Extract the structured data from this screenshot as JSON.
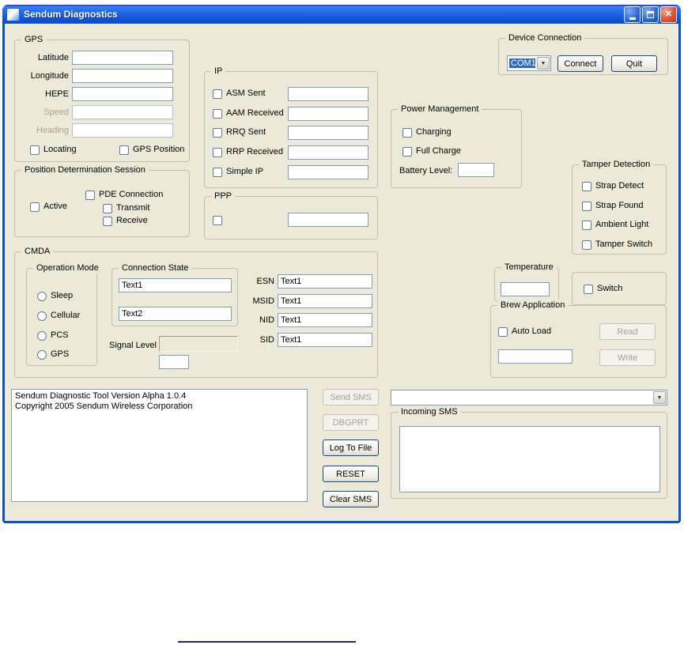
{
  "window": {
    "title": "Sendum Diagnostics"
  },
  "device_connection": {
    "label": "Device Connection",
    "port": "COM1",
    "connect": "Connect",
    "quit": "Quit"
  },
  "gps": {
    "label": "GPS",
    "rows": [
      {
        "label": "Latitude",
        "value": ""
      },
      {
        "label": "Longitude",
        "value": ""
      },
      {
        "label": "HEPE",
        "value": ""
      },
      {
        "label": "Speed",
        "value": ""
      },
      {
        "label": "Heading",
        "value": ""
      }
    ],
    "locating": "Locating",
    "gps_position": "GPS Position"
  },
  "pds": {
    "label": "Position Determination Session",
    "active": "Active",
    "pde_connection": "PDE Connection",
    "transmit": "Transmit",
    "receive": "Receive"
  },
  "ip": {
    "label": "IP",
    "rows": [
      {
        "label": "ASM Sent",
        "value": ""
      },
      {
        "label": "AAM Received",
        "value": ""
      },
      {
        "label": "RRQ Sent",
        "value": ""
      },
      {
        "label": "RRP Received",
        "value": ""
      },
      {
        "label": "Simple IP",
        "value": ""
      }
    ]
  },
  "ppp": {
    "label": "PPP",
    "value": ""
  },
  "power": {
    "label": "Power Management",
    "charging": "Charging",
    "full_charge": "Full Charge",
    "battery_label": "Battery Level:",
    "battery_value": ""
  },
  "tamper": {
    "label": "Tamper Detection",
    "items": [
      "Strap Detect",
      "Strap Found",
      "Ambient Light",
      "Tamper Switch"
    ]
  },
  "cmda": {
    "label": "CMDA",
    "operation_mode": {
      "label": "Operation Mode",
      "options": [
        "Sleep",
        "Cellular",
        "PCS",
        "GPS"
      ]
    },
    "connection_state": {
      "label": "Connection State",
      "line1": "Text1",
      "line2": "Text2"
    },
    "signal_level_label": "Signal Level",
    "signal_level_value": "",
    "ids": [
      {
        "label": "ESN",
        "value": "Text1"
      },
      {
        "label": "MSID",
        "value": "Text1"
      },
      {
        "label": "NID",
        "value": "Text1"
      },
      {
        "label": "SID",
        "value": "Text1"
      }
    ]
  },
  "temperature": {
    "label": "Temperature",
    "value": ""
  },
  "switch_box": {
    "label": "Switch"
  },
  "brew": {
    "label": "Brew Application",
    "auto_load": "Auto Load",
    "read": "Read",
    "write": "Write",
    "value": ""
  },
  "log": {
    "line1": "Sendum Diagnostic Tool Version Alpha 1.0.4",
    "line2": "Copyright 2005 Sendum Wireless Corporation"
  },
  "actions": {
    "send_sms": "Send SMS",
    "dbgprt": "DBGPRT",
    "log_to_file": "Log To File",
    "reset": "RESET",
    "clear_sms": "Clear SMS"
  },
  "sms_combo": {
    "value": ""
  },
  "incoming_sms": {
    "label": "Incoming SMS",
    "value": ""
  }
}
